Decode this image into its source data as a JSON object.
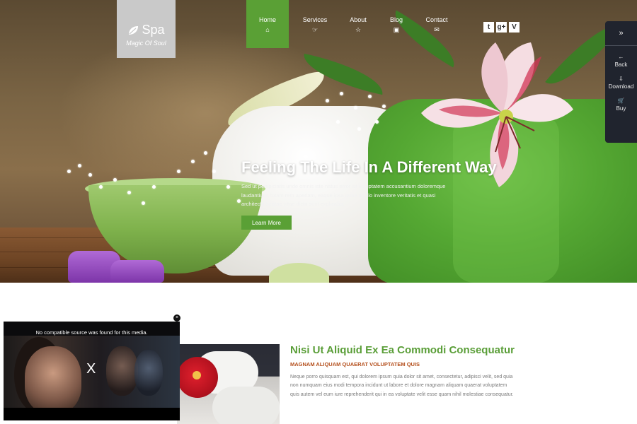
{
  "brand": {
    "name": "Spa",
    "tagline": "Magic Of Soul"
  },
  "nav": [
    {
      "label": "Home",
      "icon": "home-icon",
      "active": true
    },
    {
      "label": "Services",
      "icon": "hand-point-icon"
    },
    {
      "label": "About",
      "icon": "star-icon"
    },
    {
      "label": "Blog",
      "icon": "image-icon"
    },
    {
      "label": "Contact",
      "icon": "envelope-icon"
    }
  ],
  "social": [
    {
      "name": "twitter-icon",
      "glyph": "t"
    },
    {
      "name": "google-plus-icon",
      "glyph": "g+"
    },
    {
      "name": "vimeo-icon",
      "glyph": "V"
    }
  ],
  "side_panel": {
    "toggle_glyph": "»",
    "items": [
      {
        "label": "Back",
        "glyph": "←"
      },
      {
        "label": "Download",
        "glyph": "⇩"
      },
      {
        "label": "Buy",
        "glyph": "🛒"
      }
    ]
  },
  "hero": {
    "title": "Feeling The Life In A Different Way",
    "body": "Sed ut perspiciatis unde omnis iste natus error sit voluptatem accusantium doloremque laudantium, totam rem aperiam, eaque ipsa quae ab illo inventore veritatis et quasi architecto beatae vitae dicta sunt explicabo.",
    "button": "Learn More"
  },
  "section": {
    "title": "Nisi Ut Aliquid Ex Ea Commodi Consequatur",
    "subtitle": "MAGNAM ALIQUAM QUAERAT VOLUPTATEM QUIS",
    "body": "Neque porro quisquam est, qui dolorem ipsum quia dolor sit amet, consectetur, adipisci velit, sed quia non numquam eius modi tempora incidunt ut labore et dolore magnam aliquam quaerat voluptatem quis autem vel eum iure reprehenderit qui in ea voluptate velit esse quam nihil molestiae consequatur."
  },
  "video": {
    "message": "No compatible source was found for this media.",
    "close_glyph": "X",
    "dismiss_glyph": "×"
  },
  "colors": {
    "accent": "#5aa035",
    "subtitle": "#b44f1c",
    "panel": "#20242e",
    "logo_bg": "#c9c9c9"
  }
}
